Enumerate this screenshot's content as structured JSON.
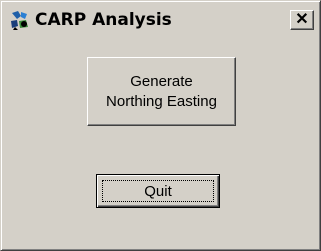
{
  "window": {
    "title": "CARP Analysis",
    "close_symbol": "✕",
    "app_icon": "app-icon",
    "bg_color": "#d4d0c8",
    "title_color": "#ffffff"
  },
  "buttons": {
    "generate_label": "Generate\nNorthing Easting",
    "quit_label": "Quit"
  }
}
